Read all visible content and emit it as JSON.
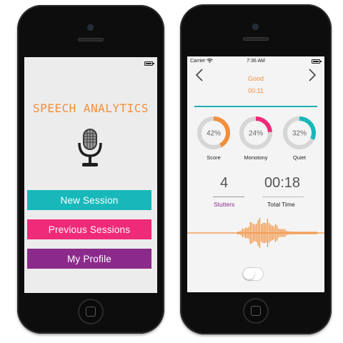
{
  "colors": {
    "accent_orange": "#f28f3b",
    "accent_teal": "#18b8ba",
    "accent_pink": "#ef2a78",
    "accent_purple": "#8c2a8c"
  },
  "left_phone": {
    "app_title": "SPEECH ANALYTICS",
    "icon": "microphone-icon",
    "buttons": [
      {
        "label": "New Session",
        "color": "#18b8ba"
      },
      {
        "label": "Previous Sessions",
        "color": "#ef2a78"
      },
      {
        "label": "My Profile",
        "color": "#8c2a8c"
      }
    ]
  },
  "right_phone": {
    "status_bar": {
      "carrier": "Carrier",
      "time": "7:36 AM"
    },
    "session": {
      "rating": "Good",
      "elapsed": "00:11"
    },
    "metrics": [
      {
        "label": "Score",
        "value_text": "42%",
        "value": 0.42,
        "color": "#f28f3b"
      },
      {
        "label": "Monotony",
        "value_text": "24%",
        "value": 0.24,
        "color": "#ef2a78"
      },
      {
        "label": "Quiet",
        "value_text": "32%",
        "value": 0.32,
        "color": "#18b8ba"
      }
    ],
    "stutters": {
      "value": "4",
      "label": "Stutters"
    },
    "total_time": {
      "value": "00:18",
      "label": "Total Time"
    },
    "toggle_on": false
  }
}
